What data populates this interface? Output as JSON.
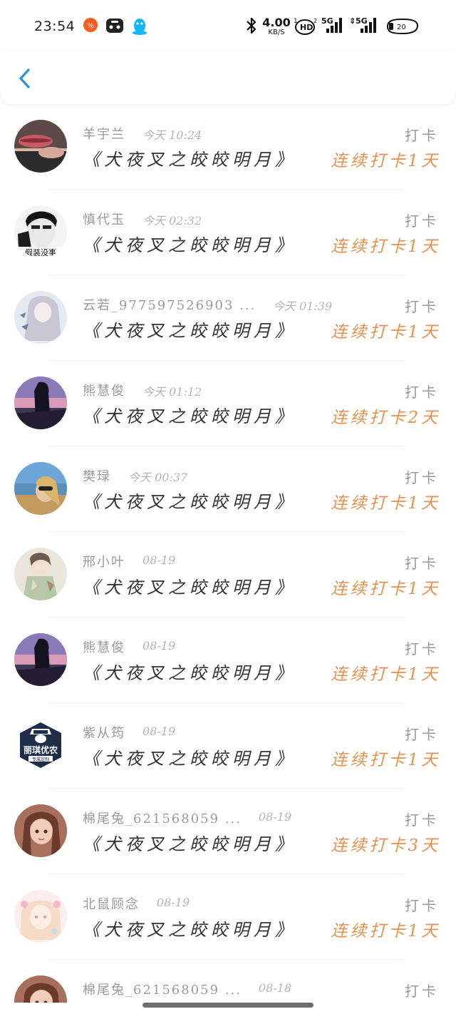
{
  "status_bar": {
    "time": "23:54",
    "net_speed": "4.00",
    "net_unit": "KB/S",
    "hd_label": "HD",
    "sig1_label": "5G",
    "sig2_label": "5G",
    "battery": "20"
  },
  "colors": {
    "accent_blue": "#2e8fe0",
    "streak_orange": "#e8904f"
  },
  "records": [
    {
      "name": "羊宇兰",
      "time": "今天 10:24",
      "book": "《犬夜叉之皎皎明月》",
      "action": "打卡",
      "streak": "连续打卡1天",
      "avatar": "lips-photo"
    },
    {
      "name": "慎代玉",
      "time": "今天 02:32",
      "book": "《犬夜叉之皎皎明月》",
      "action": "打卡",
      "streak": "连续打卡1天",
      "avatar": "bw-portrait"
    },
    {
      "name": "云若_977597526903 ...",
      "time": "今天 01:39",
      "book": "《犬夜叉之皎皎明月》",
      "action": "打卡",
      "streak": "连续打卡1天",
      "avatar": "anime-white"
    },
    {
      "name": "熊慧俊",
      "time": "今天 01:12",
      "book": "《犬夜叉之皎皎明月》",
      "action": "打卡",
      "streak": "连续打卡2天",
      "avatar": "sunset-silhouette"
    },
    {
      "name": "樊琭",
      "time": "今天 00:37",
      "book": "《犬夜叉之皎皎明月》",
      "action": "打卡",
      "streak": "连续打卡1天",
      "avatar": "beach-selfie"
    },
    {
      "name": "邢小叶",
      "time": "08-19",
      "book": "《犬夜叉之皎皎明月》",
      "action": "打卡",
      "streak": "连续打卡1天",
      "avatar": "anime-green"
    },
    {
      "name": "熊慧俊",
      "time": "08-19",
      "book": "《犬夜叉之皎皎明月》",
      "action": "打卡",
      "streak": "连续打卡1天",
      "avatar": "sunset-silhouette"
    },
    {
      "name": "紫从筠",
      "time": "08-19",
      "book": "《犬夜叉之皎皎明月》",
      "action": "打卡",
      "streak": "连续打卡1天",
      "avatar": "brand-logo",
      "avatar_text": "丽琪优农",
      "avatar_sub": "专属定制"
    },
    {
      "name": "棉尾兔_621568059 ...",
      "time": "08-19",
      "book": "《犬夜叉之皎皎明月》",
      "action": "打卡",
      "streak": "连续打卡3天",
      "avatar": "anime-brown"
    },
    {
      "name": "北鼠顾念",
      "time": "08-19",
      "book": "《犬夜叉之皎皎明月》",
      "action": "打卡",
      "streak": "连续打卡1天",
      "avatar": "anime-pink"
    },
    {
      "name": "棉尾兔_621568059 ...",
      "time": "08-18",
      "book": "",
      "action": "打卡",
      "streak": "",
      "avatar": "anime-brown"
    }
  ]
}
